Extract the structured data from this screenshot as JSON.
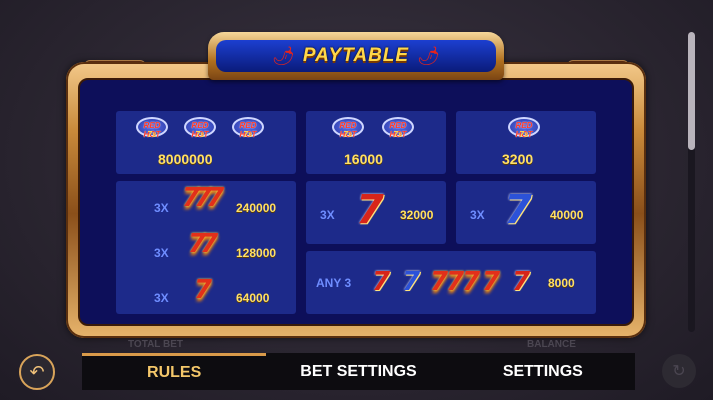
{
  "title": "PAYTABLE",
  "logo": {
    "line1": "RED HOT",
    "line2": "7s"
  },
  "row1": [
    {
      "symbols": 3,
      "payout": "8000000"
    },
    {
      "symbols": 2,
      "payout": "16000"
    },
    {
      "symbols": 1,
      "payout": "3200"
    }
  ],
  "left_panel": [
    {
      "mult": "3X",
      "payout": "240000",
      "symbol": "triple fire seven"
    },
    {
      "mult": "3X",
      "payout": "128000",
      "symbol": "double fire seven"
    },
    {
      "mult": "3X",
      "payout": "64000",
      "symbol": "single fire seven"
    }
  ],
  "red_seven": {
    "mult": "3X",
    "payout": "32000",
    "glyph": "7"
  },
  "blue_seven": {
    "mult": "3X",
    "payout": "40000",
    "glyph": "7"
  },
  "any3": {
    "label": "ANY 3",
    "payout": "8000",
    "glyphs": [
      "7",
      "7",
      "7",
      "7",
      "7",
      "7",
      "7"
    ]
  },
  "tabs": [
    {
      "label": "RULES",
      "active": true
    },
    {
      "label": "BET SETTINGS",
      "active": false
    },
    {
      "label": "SETTINGS",
      "active": false
    }
  ],
  "background_labels": {
    "total_bet": "TOTAL BET",
    "balance": "BALANCE"
  },
  "colors": {
    "accent": "#f4c76a",
    "panel": "#0d0f5a",
    "cell": "#1d2a8a",
    "payout": "#ffe066"
  },
  "icons": {
    "back": "back-arrow-icon",
    "pepper": "chili-pepper-icon"
  }
}
